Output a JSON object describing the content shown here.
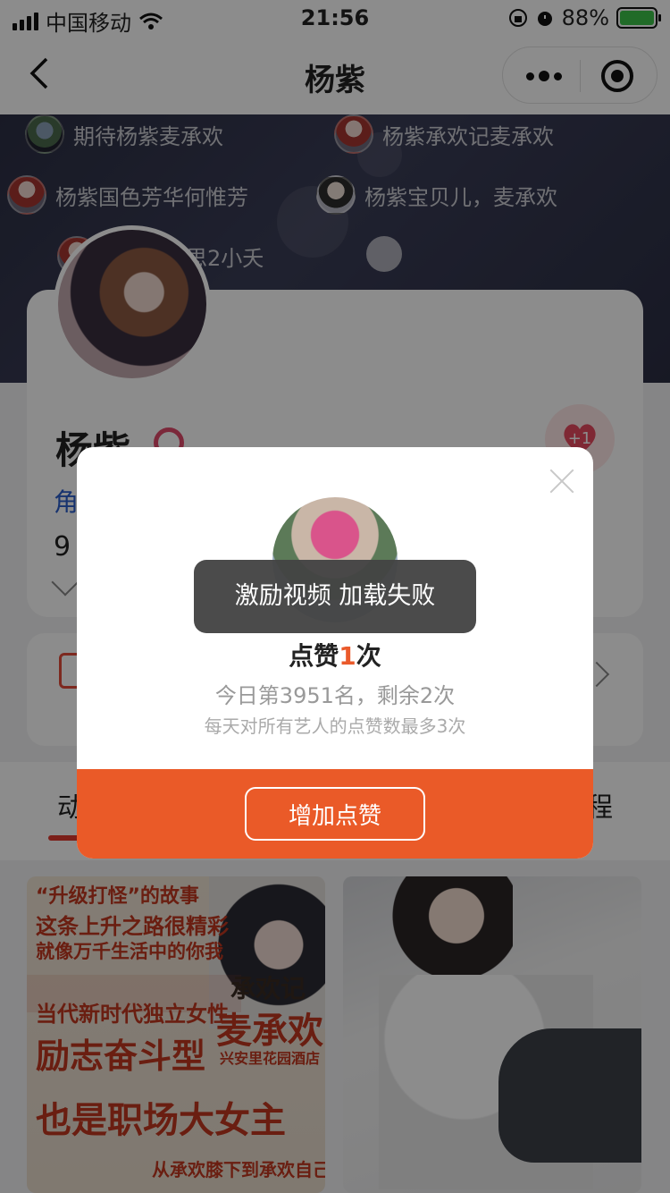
{
  "status_bar": {
    "carrier": "中国移动",
    "time": "21:56",
    "battery_percent": "88%"
  },
  "nav": {
    "title": "杨紫"
  },
  "danmu": [
    {
      "text": "期待杨紫麦承欢"
    },
    {
      "text": "杨紫承欢记麦承欢"
    },
    {
      "text": "杨紫国色芳华何惟芳"
    },
    {
      "text": "杨紫宝贝儿，麦承欢"
    },
    {
      "text": "思2小夭"
    }
  ],
  "profile": {
    "name": "杨紫",
    "role_prefix": "角",
    "count_prefix": "9",
    "like_plus": "+1"
  },
  "tabs": {
    "first_visible": "动",
    "last_visible": "程"
  },
  "feed": {
    "left_poster_lines": [
      "“升级打怪”的故事",
      "这条上升之路很精彩",
      "就像万千生活中的你我",
      "当代新时代独立女性",
      "励志奋斗型",
      "承欢记",
      "麦承欢",
      "兴安里花园酒店",
      "也是职场大女主",
      "从承欢膝下到承欢自己"
    ]
  },
  "modal": {
    "like_prefix": "点赞",
    "like_count": "1",
    "like_suffix": "次",
    "rank_text": "今日第3951名，剩余2次",
    "limit_text": "每天对所有艺人的点赞数最多3次",
    "add_button": "增加点赞"
  },
  "toast": {
    "text": "激励视频 加载失败"
  },
  "colors": {
    "accent": "#ea5a28",
    "link_blue": "#2a5ecb",
    "banner_bg": "#2c2f44"
  }
}
